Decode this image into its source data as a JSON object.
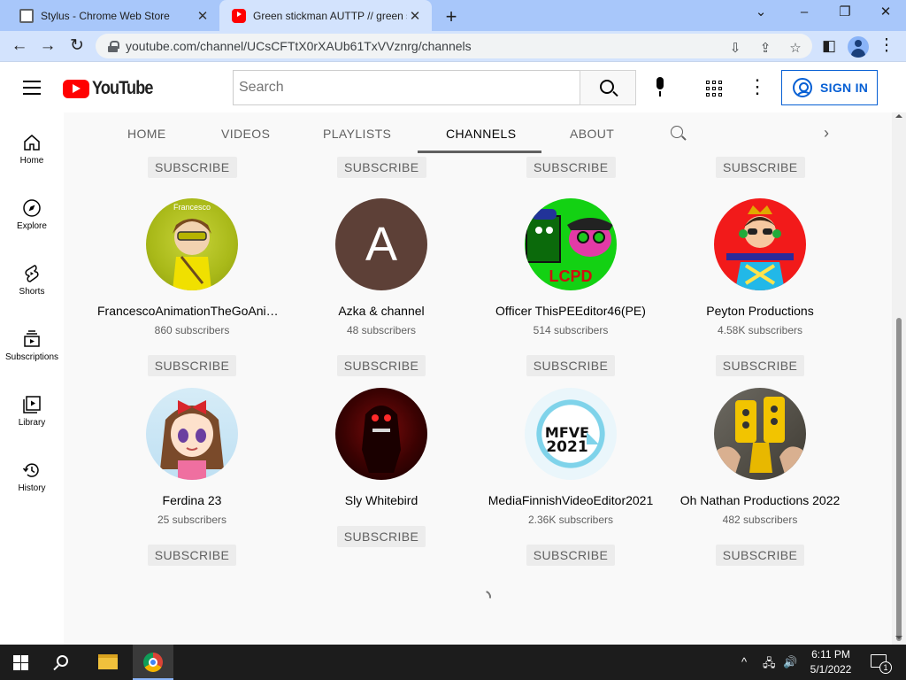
{
  "browser": {
    "tabs": [
      {
        "title": "Stylus - Chrome Web Store"
      },
      {
        "title": "Green stickman AUTTP // green stickman"
      }
    ],
    "url": "youtube.com/channel/UCsCFTtX0rXAUb61TxVVznrg/channels"
  },
  "masthead": {
    "logo_text": "YouTube",
    "search_placeholder": "Search",
    "signin_label": "SIGN IN"
  },
  "guide": [
    {
      "label": "Home",
      "icon": "home-icon"
    },
    {
      "label": "Explore",
      "icon": "compass-icon"
    },
    {
      "label": "Shorts",
      "icon": "shorts-icon"
    },
    {
      "label": "Subscriptions",
      "icon": "subscriptions-icon"
    },
    {
      "label": "Library",
      "icon": "library-icon"
    },
    {
      "label": "History",
      "icon": "history-icon"
    }
  ],
  "channel_tabs": [
    "HOME",
    "VIDEOS",
    "PLAYLISTS",
    "CHANNELS",
    "ABOUT"
  ],
  "active_tab": "CHANNELS",
  "subscribe_label": "SUBSCRIBE",
  "channels": [
    {
      "name": "FrancescoAnimationTheGoAnimator",
      "subs": "860 subscribers",
      "avatar_text": "Francesco"
    },
    {
      "name": "Azka & channel",
      "subs": "48 subscribers",
      "avatar_text": "A"
    },
    {
      "name": "Officer ThisPEEditor46(PE)",
      "subs": "514 subscribers",
      "avatar_text": "LCPD"
    },
    {
      "name": "Peyton Productions",
      "subs": "4.58K subscribers",
      "avatar_text": ""
    },
    {
      "name": "Ferdina 23",
      "subs": "25 subscribers",
      "avatar_text": ""
    },
    {
      "name": "Sly Whitebird",
      "subs": "",
      "avatar_text": ""
    },
    {
      "name": "MediaFinnishVideoEditor2021",
      "subs": "2.36K subscribers",
      "avatar_text": "MFVE 2021"
    },
    {
      "name": "Oh Nathan Productions 2022",
      "subs": "482 subscribers",
      "avatar_text": ""
    }
  ],
  "taskbar": {
    "time": "6:11 PM",
    "date": "5/1/2022",
    "notification_count": "1"
  },
  "colors": {
    "youtube_red": "#ff0000",
    "signin_blue": "#065fd4",
    "tab_strip": "#a8c7fa",
    "taskbar": "#1c1c1c"
  }
}
